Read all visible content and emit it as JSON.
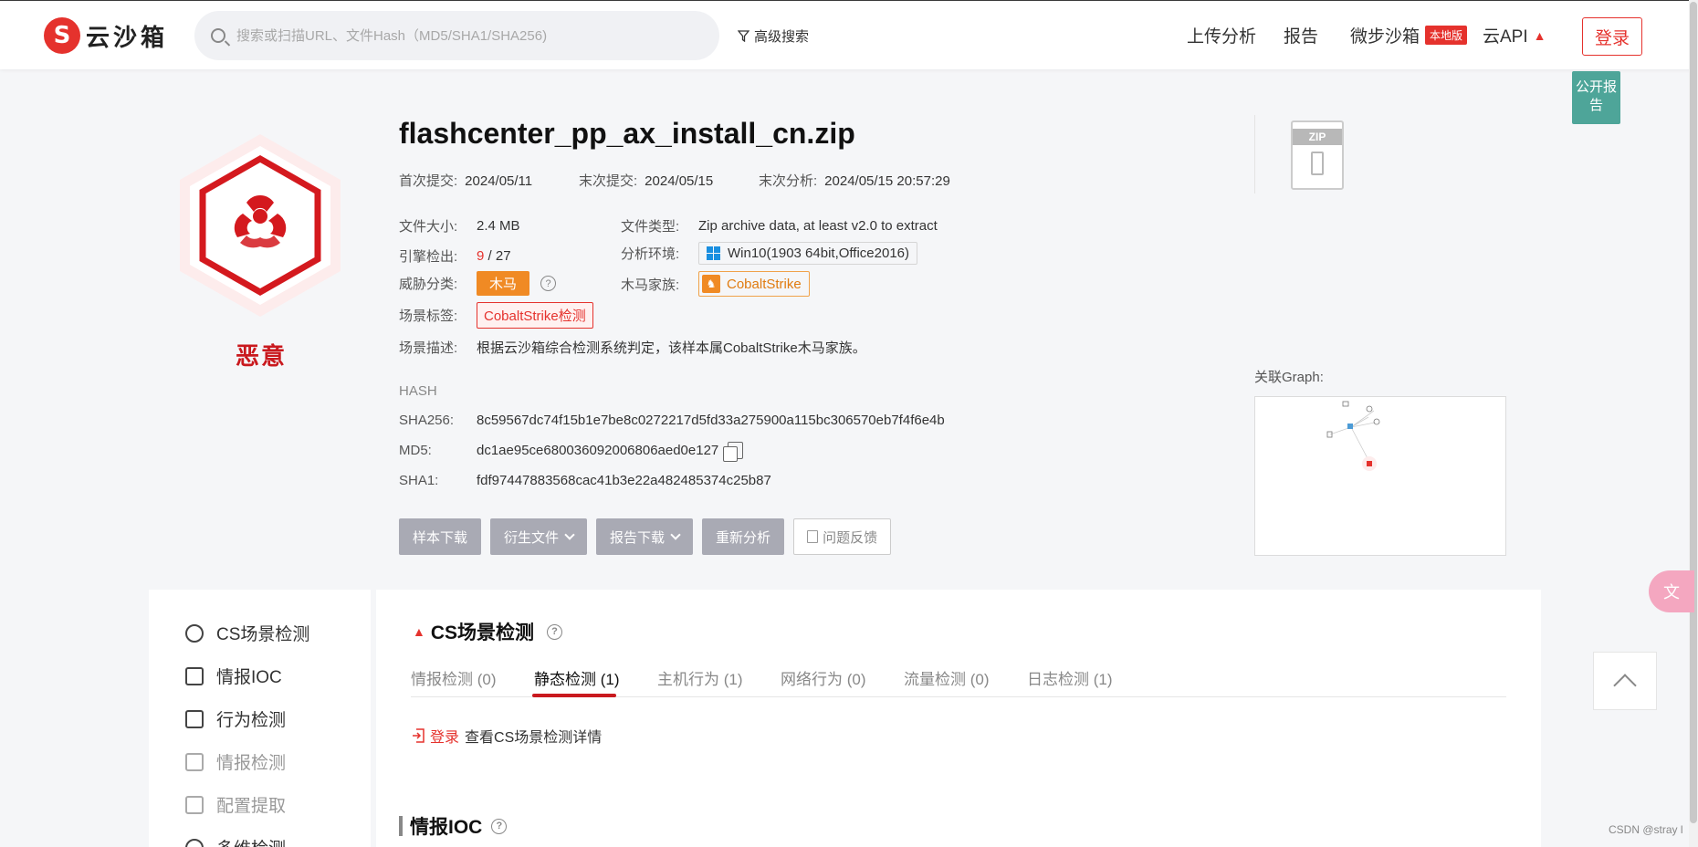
{
  "header": {
    "logo_text": "云沙箱",
    "logo_mark": "S",
    "search_placeholder": "搜索或扫描URL、文件Hash（MD5/SHA1/SHA256)",
    "advanced_search": "高级搜索",
    "nav": {
      "upload": "上传分析",
      "reports": "报告",
      "micro_sandbox": "微步沙箱",
      "local_badge": "本地版",
      "cloud_api": "云API",
      "login": "登录"
    }
  },
  "public_report": "公开报告",
  "verdict": "恶意",
  "file": {
    "name": "flashcenter_pp_ax_install_cn.zip",
    "first_submit_label": "首次提交:",
    "first_submit": "2024/05/11",
    "last_submit_label": "末次提交:",
    "last_submit": "2024/05/15",
    "last_analysis_label": "末次分析:",
    "last_analysis": "2024/05/15 20:57:29",
    "size_label": "文件大小:",
    "size": "2.4 MB",
    "type_label": "文件类型:",
    "type": "Zip archive data, at least v2.0 to extract",
    "engine_label": "引擎检出:",
    "engine_hits": "9",
    "engine_total": "/ 27",
    "env_label": "分析环境:",
    "env": "Win10(1903 64bit,Office2016)",
    "threat_label": "威胁分类:",
    "threat": "木马",
    "family_label": "木马家族:",
    "family": "CobaltStrike",
    "scene_tag_label": "场景标签:",
    "scene_tag": "CobaltStrike检测",
    "scene_desc_label": "场景描述:",
    "scene_desc": "根据云沙箱综合检测系统判定，该样本属CobaltStrike木马家族。"
  },
  "hash": {
    "heading": "HASH",
    "sha256_label": "SHA256:",
    "sha256": "8c59567dc74f15b1e7be8c0272217d5fd33a275900a115bc306570eb7f4f6e4b",
    "md5_label": "MD5:",
    "md5": "dc1ae95ce680036092006806aed0e127",
    "sha1_label": "SHA1:",
    "sha1": "fdf97447883568cac41b3e22a482485374c25b87"
  },
  "buttons": {
    "sample_download": "样本下载",
    "derived_files": "衍生文件",
    "report_download": "报告下载",
    "reanalyze": "重新分析",
    "feedback": "问题反馈"
  },
  "file_icon_label": "ZIP",
  "graph_label": "关联Graph:",
  "sidebar": [
    {
      "label": "CS场景检测",
      "dim": false
    },
    {
      "label": "情报IOC",
      "dim": false
    },
    {
      "label": "行为检测",
      "dim": false
    },
    {
      "label": "情报检测",
      "dim": true
    },
    {
      "label": "配置提取",
      "dim": true
    },
    {
      "label": "多维检测",
      "dim": false
    }
  ],
  "section": {
    "title": "CS场景检测",
    "tabs": [
      "情报检测 (0)",
      "静态检测 (1)",
      "主机行为 (1)",
      "网络行为 (0)",
      "流量检测 (0)",
      "日志检测 (1)"
    ],
    "active_tab": 1,
    "login_link": "登录",
    "login_hint": "查看CS场景检测详情"
  },
  "ioc_title": "情报IOC",
  "watermark": "CSDN @stray l",
  "colors": {
    "brand_red": "#e5322d",
    "verdict_red": "#c9191e",
    "trojan_orange": "#f08a24",
    "teal": "#4ea599"
  }
}
